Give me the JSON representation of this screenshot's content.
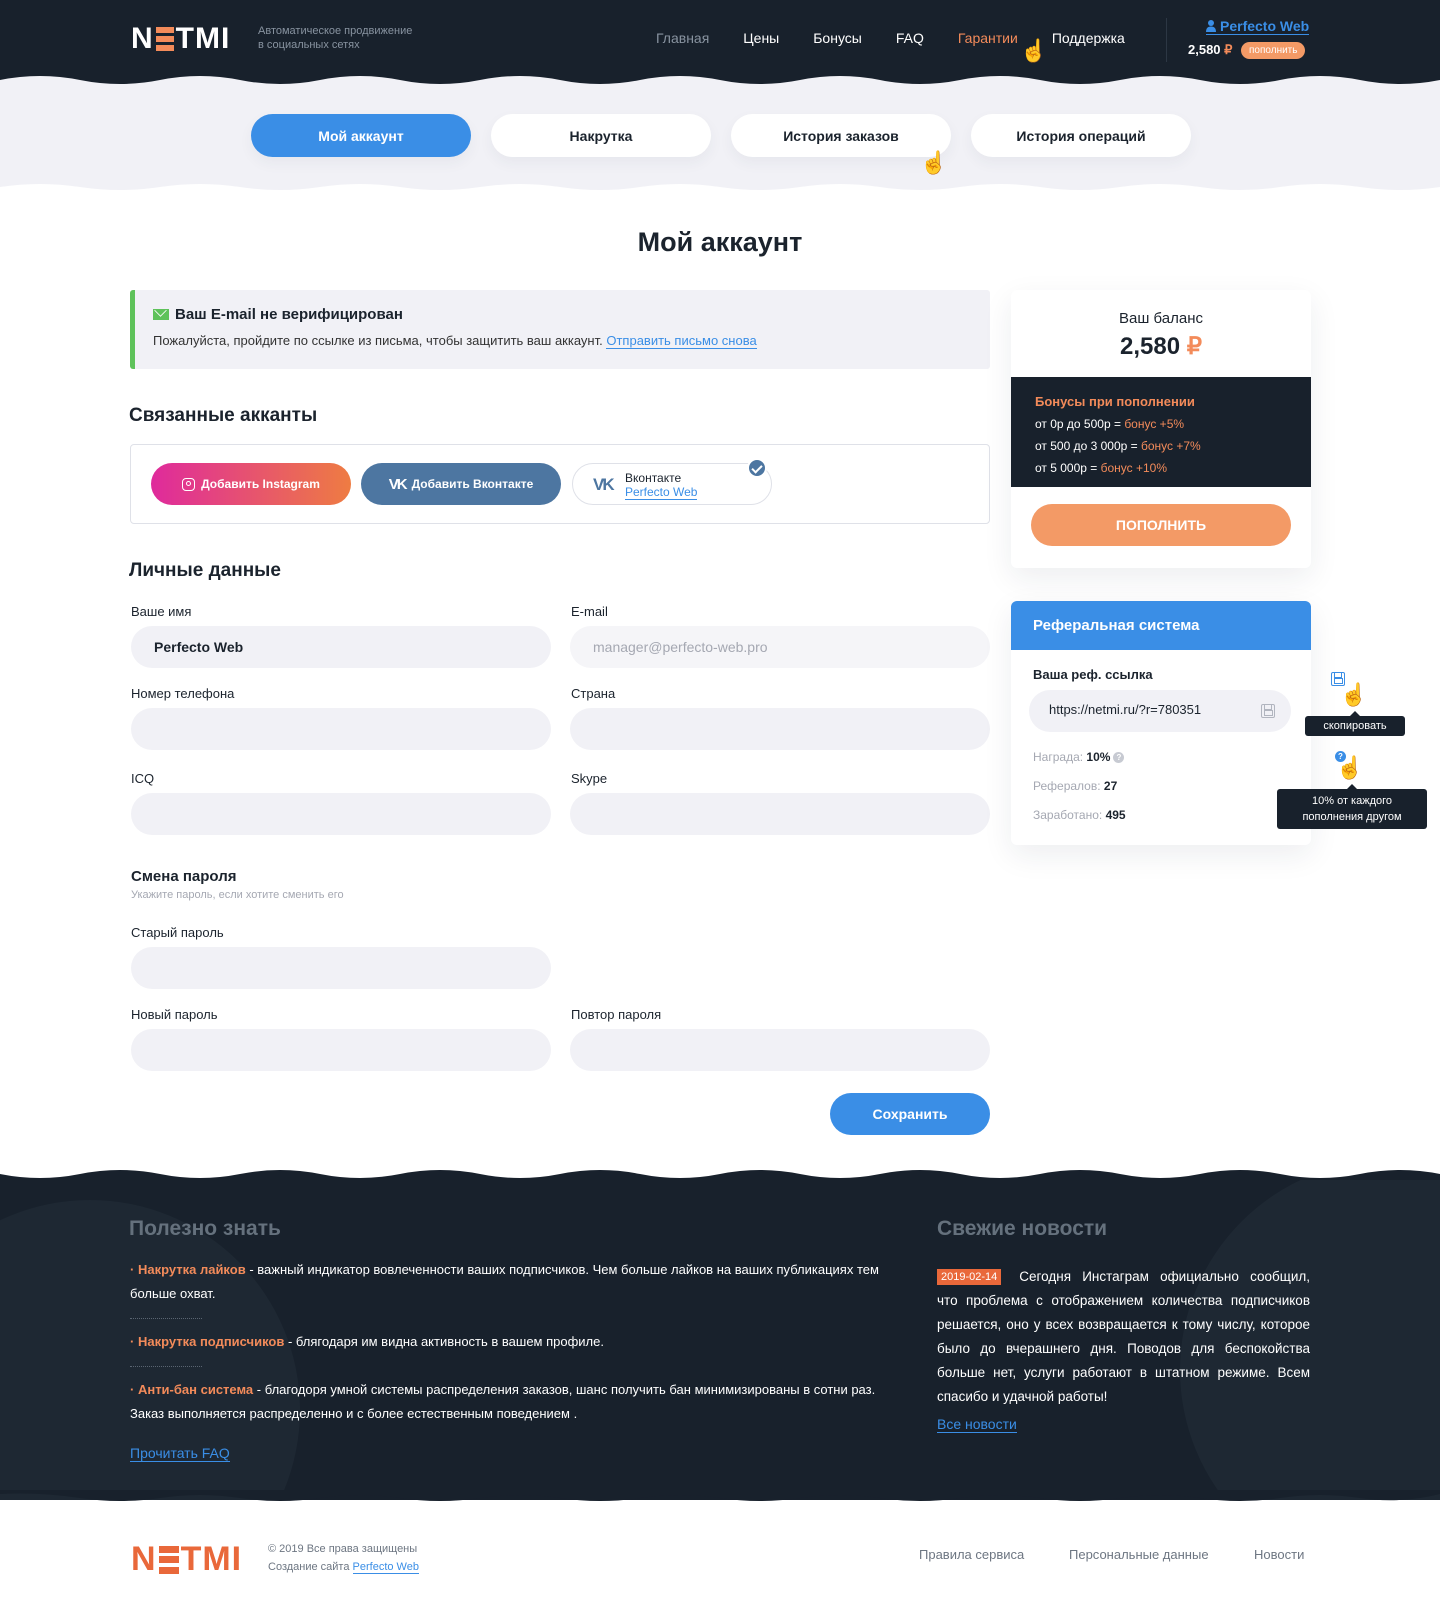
{
  "header": {
    "logo": "NETMI",
    "tagline_1": "Автоматическое продвижение",
    "tagline_2": "в социальных сетях",
    "nav": [
      {
        "label": "Главная",
        "state": "muted"
      },
      {
        "label": "Цены",
        "state": "normal"
      },
      {
        "label": "Бонусы",
        "state": "normal"
      },
      {
        "label": "FAQ",
        "state": "normal"
      },
      {
        "label": "Гарантии",
        "state": "active"
      },
      {
        "label": "Поддержка",
        "state": "normal"
      }
    ],
    "user_name": "Perfecto Web",
    "balance": "2,580",
    "currency": "₽",
    "topup_label": "пополнить"
  },
  "tabs": [
    {
      "label": "Мой аккаунт",
      "active": true
    },
    {
      "label": "Накрутка",
      "active": false
    },
    {
      "label": "История заказов",
      "active": false
    },
    {
      "label": "История операций",
      "active": false
    }
  ],
  "page_title": "Мой аккаунт",
  "alert": {
    "title": "Ваш E-mail не верифицирован",
    "text": "Пожалуйста, пройдите по ссылке из письма, чтобы защитить ваш аккаунт.",
    "link": "Отправить письмо снова"
  },
  "linked": {
    "title": "Связанные акканты",
    "add_instagram": "Добавить Instagram",
    "add_vk": "Добавить Вконтакте",
    "vk_card_title": "Вконтакте",
    "vk_card_user": "Perfecto Web"
  },
  "personal": {
    "title": "Личные данные",
    "fields": {
      "name": {
        "label": "Ваше имя",
        "value": "Perfecto Web"
      },
      "email": {
        "label": "E-mail",
        "value": "manager@perfecto-web.pro"
      },
      "phone": {
        "label": "Номер телефона",
        "value": ""
      },
      "country": {
        "label": "Страна",
        "value": ""
      },
      "icq": {
        "label": "ICQ",
        "value": ""
      },
      "skype": {
        "label": "Skype",
        "value": ""
      }
    }
  },
  "password": {
    "title": "Смена пароля",
    "note": "Укажите пароль, если хотите сменить его",
    "old_label": "Старый пароль",
    "new_label": "Новый пароль",
    "repeat_label": "Повтор пароля",
    "save_label": "Сохранить"
  },
  "balance_card": {
    "title": "Ваш баланс",
    "amount": "2,580",
    "currency": "₽",
    "bonus_title": "Бонусы при пополнении",
    "bonus_rows": [
      {
        "range": "от 0р до 500р = ",
        "bonus": "бонус +5%"
      },
      {
        "range": "от 500 до 3 000р = ",
        "bonus": "бонус +7%"
      },
      {
        "range": "от 5 000р = ",
        "bonus": "бонус +10%"
      }
    ],
    "topup_label": "ПОПОЛНИТЬ"
  },
  "referral": {
    "title": "Реферальная система",
    "link_label": "Ваша реф. ссылка",
    "link_value": "https://netmi.ru/?r=780351",
    "reward_label": "Награда:",
    "reward_value": "10%",
    "referrals_label": "Рефералов:",
    "referrals_value": "27",
    "earned_label": "Заработано:",
    "earned_value": "495",
    "tooltip_copy": "скопировать",
    "tooltip_help_1": "10% от каждого",
    "tooltip_help_2": "пополнения другом"
  },
  "footer": {
    "faq_title": "Полезно знать",
    "faq_items": [
      {
        "term": "Накрутка лайков",
        "text": " - важный индикатор вовлеченности  ваших подписчиков. Чем больше лайков на ваших публикациях тем больше охват."
      },
      {
        "term": "Накрутка подписчиков",
        "text": " - блягодаря им видна активность в вашем профиле."
      },
      {
        "term": "Анти-бан система",
        "text": " - благодоря умной системы распределения заказов, шанс получить бан минимизированы в сотни раз. Заказ выполняется распределенно и с более естественным поведением ."
      }
    ],
    "faq_link": "Прочитать FAQ",
    "news_title": "Свежие новости",
    "news_date": "2019-02-14",
    "news_text": "Сегодня Инстаграм официально сообщил, что проблема с отображением количества подписчиков решается, оно у всех возвращается к тому числу, которое было до вчерашнего дня. Поводов для беспокойства больше нет, услуги работают в штатном режиме. Всем спасибо и удачной работы!",
    "news_link": "Все новости"
  },
  "bottom": {
    "logo": "NETMI",
    "copyright": "© 2019 Все права защищены",
    "made_by": "Создание сайта",
    "made_by_link": "Perfecto Web",
    "links": [
      "Правила сервиса",
      "Персональные данные",
      "Новости"
    ]
  }
}
